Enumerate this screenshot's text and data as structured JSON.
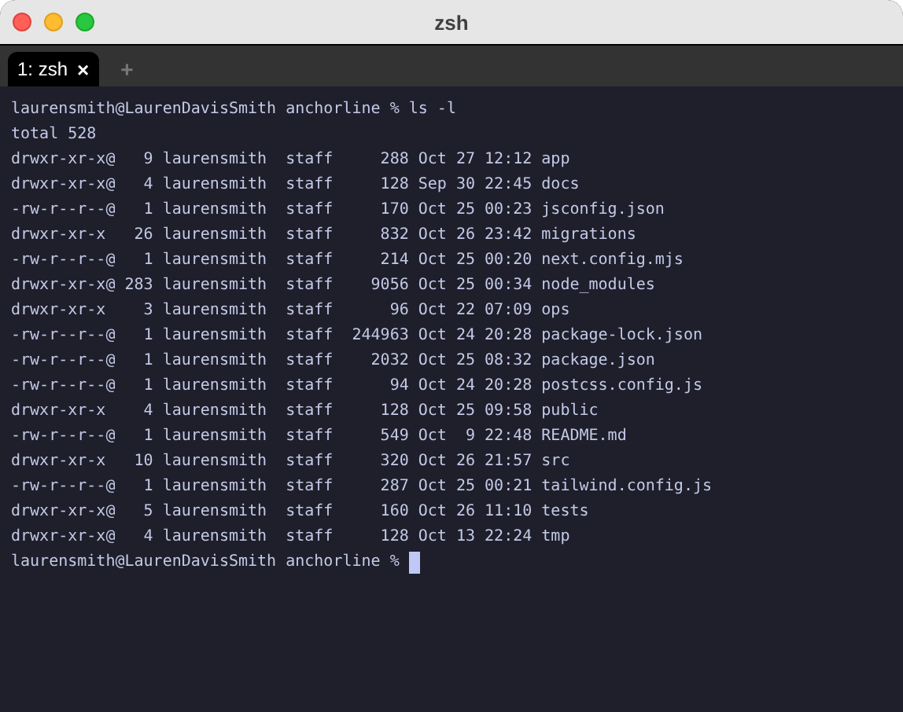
{
  "window": {
    "title": "zsh"
  },
  "tabs": [
    {
      "label": "1: zsh",
      "close": "×",
      "selected": true
    }
  ],
  "new_tab": "+",
  "terminal": {
    "lines": [
      "laurensmith@LaurenDavisSmith anchorline % ls -l",
      "total 528",
      "drwxr-xr-x@   9 laurensmith  staff     288 Oct 27 12:12 app",
      "drwxr-xr-x@   4 laurensmith  staff     128 Sep 30 22:45 docs",
      "-rw-r--r--@   1 laurensmith  staff     170 Oct 25 00:23 jsconfig.json",
      "drwxr-xr-x   26 laurensmith  staff     832 Oct 26 23:42 migrations",
      "-rw-r--r--@   1 laurensmith  staff     214 Oct 25 00:20 next.config.mjs",
      "drwxr-xr-x@ 283 laurensmith  staff    9056 Oct 25 00:34 node_modules",
      "drwxr-xr-x    3 laurensmith  staff      96 Oct 22 07:09 ops",
      "-rw-r--r--@   1 laurensmith  staff  244963 Oct 24 20:28 package-lock.json",
      "-rw-r--r--@   1 laurensmith  staff    2032 Oct 25 08:32 package.json",
      "-rw-r--r--@   1 laurensmith  staff      94 Oct 24 20:28 postcss.config.js",
      "drwxr-xr-x    4 laurensmith  staff     128 Oct 25 09:58 public",
      "-rw-r--r--@   1 laurensmith  staff     549 Oct  9 22:48 README.md",
      "drwxr-xr-x   10 laurensmith  staff     320 Oct 26 21:57 src",
      "-rw-r--r--@   1 laurensmith  staff     287 Oct 25 00:21 tailwind.config.js",
      "drwxr-xr-x@   5 laurensmith  staff     160 Oct 26 11:10 tests",
      "drwxr-xr-x@   4 laurensmith  staff     128 Oct 13 22:24 tmp"
    ],
    "prompt": "laurensmith@LaurenDavisSmith anchorline %"
  }
}
